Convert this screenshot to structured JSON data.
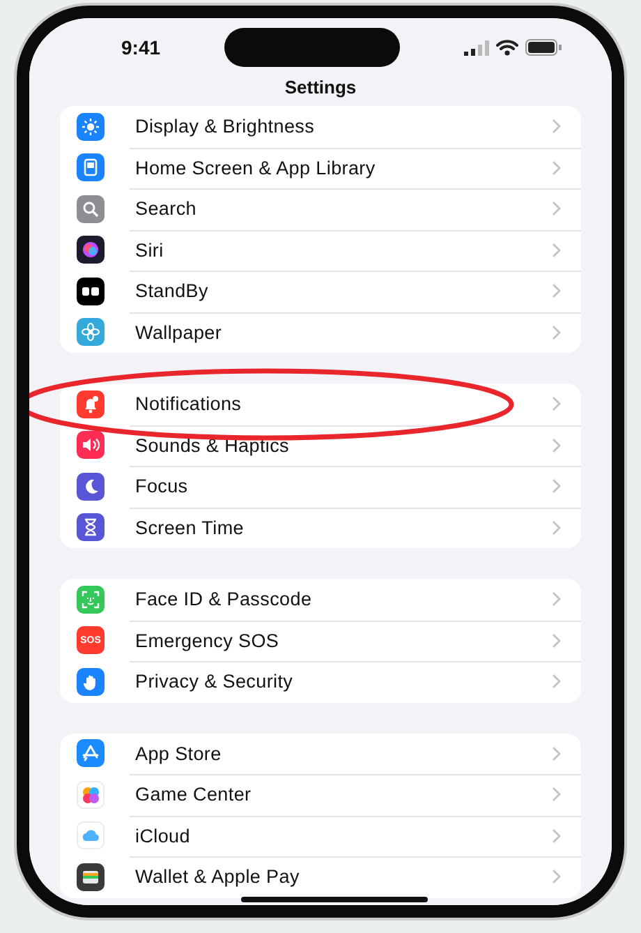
{
  "status_bar": {
    "time": "9:41"
  },
  "title": "Settings",
  "groups": [
    {
      "items": [
        {
          "label": "Display & Brightness",
          "color": "#1a84ff"
        },
        {
          "label": "Home Screen & App Library",
          "color": "#1a84ff"
        },
        {
          "label": "Search",
          "color": "#8e8e93"
        },
        {
          "label": "Siri",
          "color": "#1c1c2e"
        },
        {
          "label": "StandBy",
          "color": "#000000"
        },
        {
          "label": "Wallpaper",
          "color": "#34aadc"
        }
      ]
    },
    {
      "items": [
        {
          "label": "Notifications",
          "color": "#ff3b30"
        },
        {
          "label": "Sounds & Haptics",
          "color": "#ff2d55"
        },
        {
          "label": "Focus",
          "color": "#5856d6"
        },
        {
          "label": "Screen Time",
          "color": "#5856d6"
        }
      ]
    },
    {
      "items": [
        {
          "label": "Face ID & Passcode",
          "color": "#34c759"
        },
        {
          "label": "Emergency SOS",
          "color": "#ff3b30",
          "icon_text": "SOS"
        },
        {
          "label": "Privacy & Security",
          "color": "#1a84ff"
        }
      ]
    },
    {
      "items": [
        {
          "label": "App Store",
          "color": "#1a8cff"
        },
        {
          "label": "Game Center",
          "color": "#ffffff"
        },
        {
          "label": "iCloud",
          "color": "#ffffff"
        },
        {
          "label": "Wallet & Apple Pay",
          "color": "#3a3a3c"
        }
      ]
    }
  ]
}
